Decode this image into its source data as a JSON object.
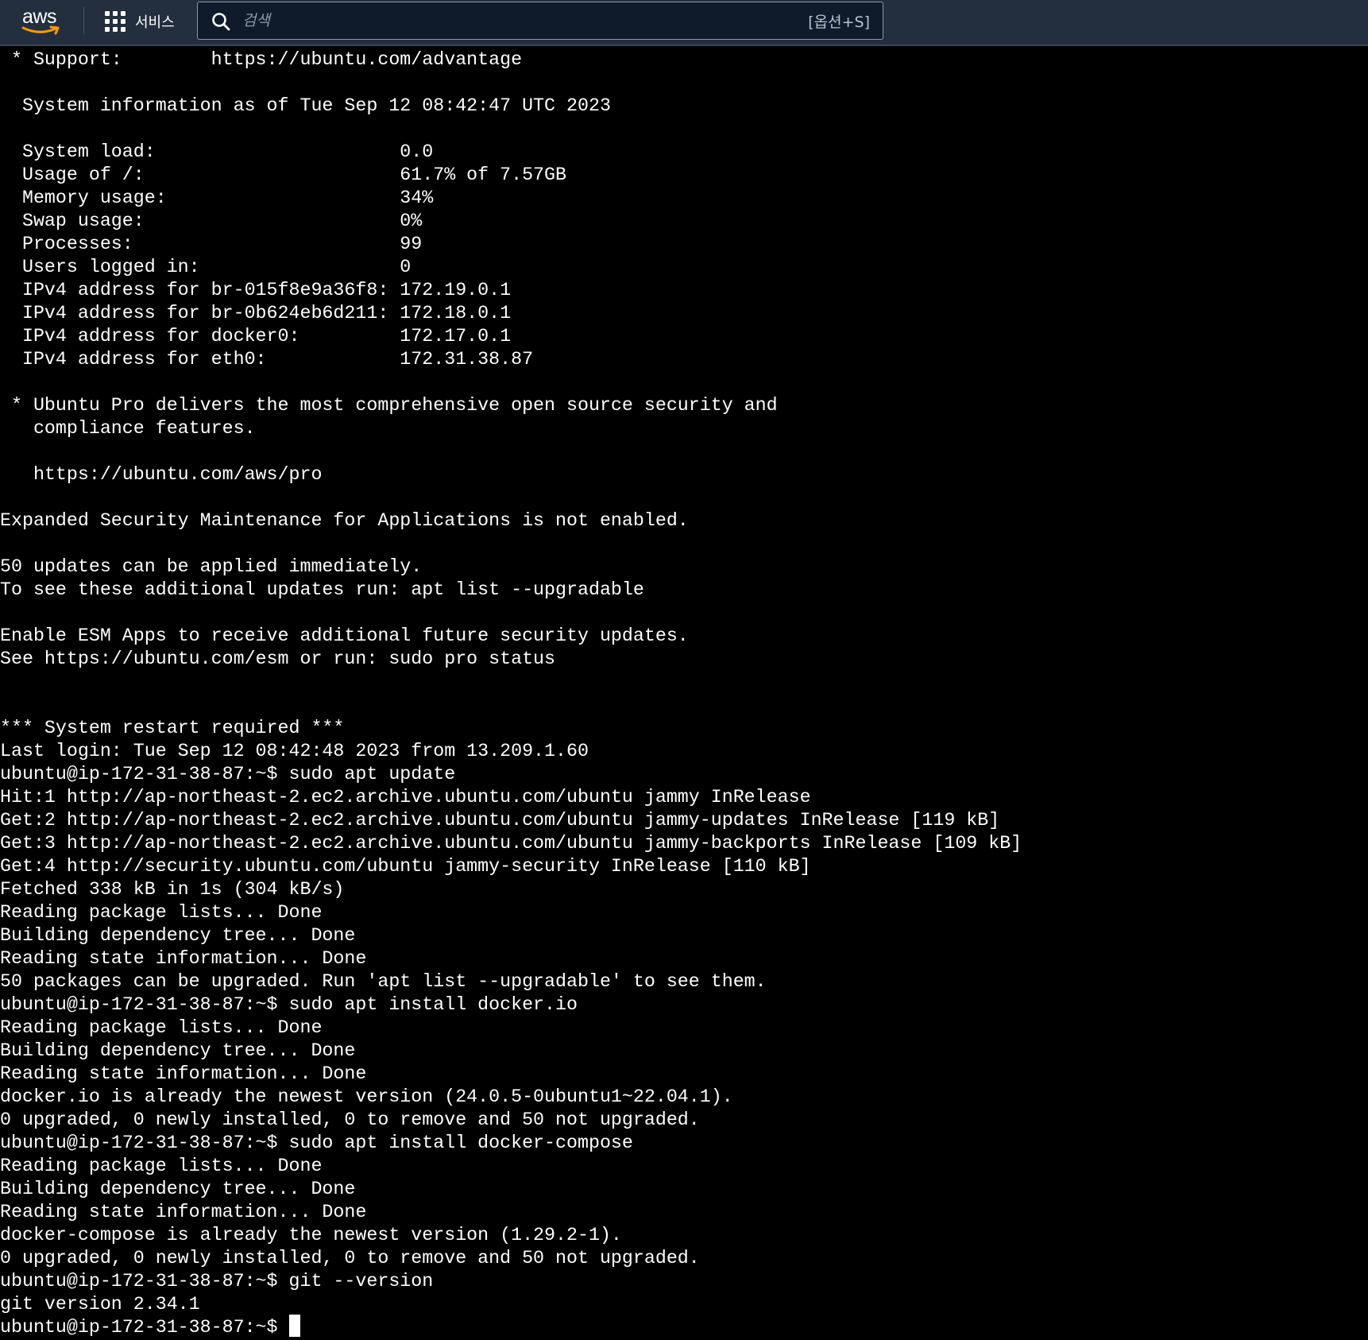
{
  "topbar": {
    "logo_text": "aws",
    "services_label": "서비스",
    "search": {
      "placeholder": "검색",
      "value": "",
      "shortcut": "[옵션+S]"
    }
  },
  "terminal": {
    "lines": [
      " * Support:        https://ubuntu.com/advantage",
      "",
      "  System information as of Tue Sep 12 08:42:47 UTC 2023",
      "",
      "  System load:                      0.0",
      "  Usage of /:                       61.7% of 7.57GB",
      "  Memory usage:                     34%",
      "  Swap usage:                       0%",
      "  Processes:                        99",
      "  Users logged in:                  0",
      "  IPv4 address for br-015f8e9a36f8: 172.19.0.1",
      "  IPv4 address for br-0b624eb6d211: 172.18.0.1",
      "  IPv4 address for docker0:         172.17.0.1",
      "  IPv4 address for eth0:            172.31.38.87",
      "",
      " * Ubuntu Pro delivers the most comprehensive open source security and",
      "   compliance features.",
      "",
      "   https://ubuntu.com/aws/pro",
      "",
      "Expanded Security Maintenance for Applications is not enabled.",
      "",
      "50 updates can be applied immediately.",
      "To see these additional updates run: apt list --upgradable",
      "",
      "Enable ESM Apps to receive additional future security updates.",
      "See https://ubuntu.com/esm or run: sudo pro status",
      "",
      "",
      "*** System restart required ***",
      "Last login: Tue Sep 12 08:42:48 2023 from 13.209.1.60",
      "ubuntu@ip-172-31-38-87:~$ sudo apt update",
      "Hit:1 http://ap-northeast-2.ec2.archive.ubuntu.com/ubuntu jammy InRelease",
      "Get:2 http://ap-northeast-2.ec2.archive.ubuntu.com/ubuntu jammy-updates InRelease [119 kB]",
      "Get:3 http://ap-northeast-2.ec2.archive.ubuntu.com/ubuntu jammy-backports InRelease [109 kB]",
      "Get:4 http://security.ubuntu.com/ubuntu jammy-security InRelease [110 kB]",
      "Fetched 338 kB in 1s (304 kB/s)",
      "Reading package lists... Done",
      "Building dependency tree... Done",
      "Reading state information... Done",
      "50 packages can be upgraded. Run 'apt list --upgradable' to see them.",
      "ubuntu@ip-172-31-38-87:~$ sudo apt install docker.io",
      "Reading package lists... Done",
      "Building dependency tree... Done",
      "Reading state information... Done",
      "docker.io is already the newest version (24.0.5-0ubuntu1~22.04.1).",
      "0 upgraded, 0 newly installed, 0 to remove and 50 not upgraded.",
      "ubuntu@ip-172-31-38-87:~$ sudo apt install docker-compose",
      "Reading package lists... Done",
      "Building dependency tree... Done",
      "Reading state information... Done",
      "docker-compose is already the newest version (1.29.2-1).",
      "0 upgraded, 0 newly installed, 0 to remove and 50 not upgraded.",
      "ubuntu@ip-172-31-38-87:~$ git --version",
      "git version 2.34.1",
      "ubuntu@ip-172-31-38-87:~$ "
    ]
  }
}
